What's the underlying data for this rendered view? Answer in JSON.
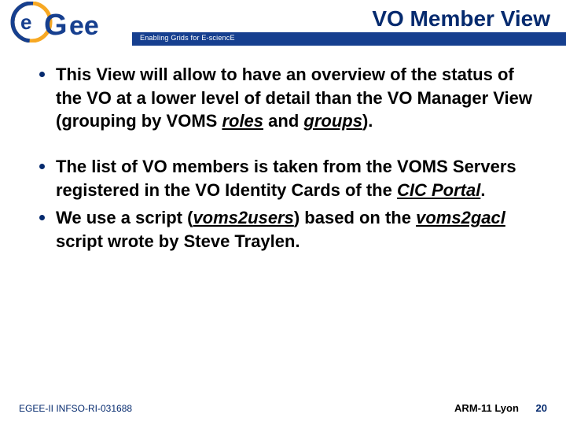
{
  "header": {
    "logo_text": "eGee",
    "title": "VO Member View",
    "tagline": "Enabling Grids for E-sciencE"
  },
  "bullets": {
    "b1_pre": "This View will allow to have an overview of the status of the VO at a lower level of detail than the VO Manager View (grouping by VOMS ",
    "b1_u1": "roles",
    "b1_mid": " and ",
    "b1_u2": "groups",
    "b1_post": ").",
    "b2_pre": "The list of VO members is taken from the VOMS Servers registered in the VO Identity Cards of the ",
    "b2_u1": "CIC Portal",
    "b2_post": ".",
    "b3_pre": "We use a script (",
    "b3_u1": "voms2users",
    "b3_mid": ") based on the ",
    "b3_u2": "voms2gacl",
    "b3_post": " script wrote by Steve Traylen."
  },
  "footer": {
    "left": "EGEE-II INFSO-RI-031688",
    "right_label": "ARM-11 Lyon",
    "page": "20"
  }
}
